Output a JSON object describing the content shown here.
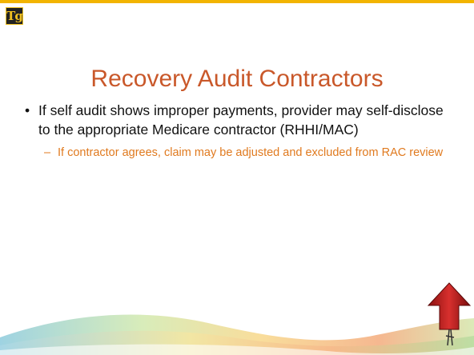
{
  "slide": {
    "logo_text": "Tg",
    "title": "Recovery Audit Contractors",
    "bullet": "If self audit shows improper payments, provider may self-disclose to the appropriate Medicare contractor (RHHI/MAC)",
    "sub_bullet": "If contractor agrees, claim may be adjusted and excluded from RAC review",
    "bullet_marker": "•",
    "sub_marker": "–"
  },
  "colors": {
    "title": "#c9582a",
    "sub_bullet": "#e07a1f",
    "top_bar": "#f2b400",
    "arrow": "#c0202a"
  }
}
